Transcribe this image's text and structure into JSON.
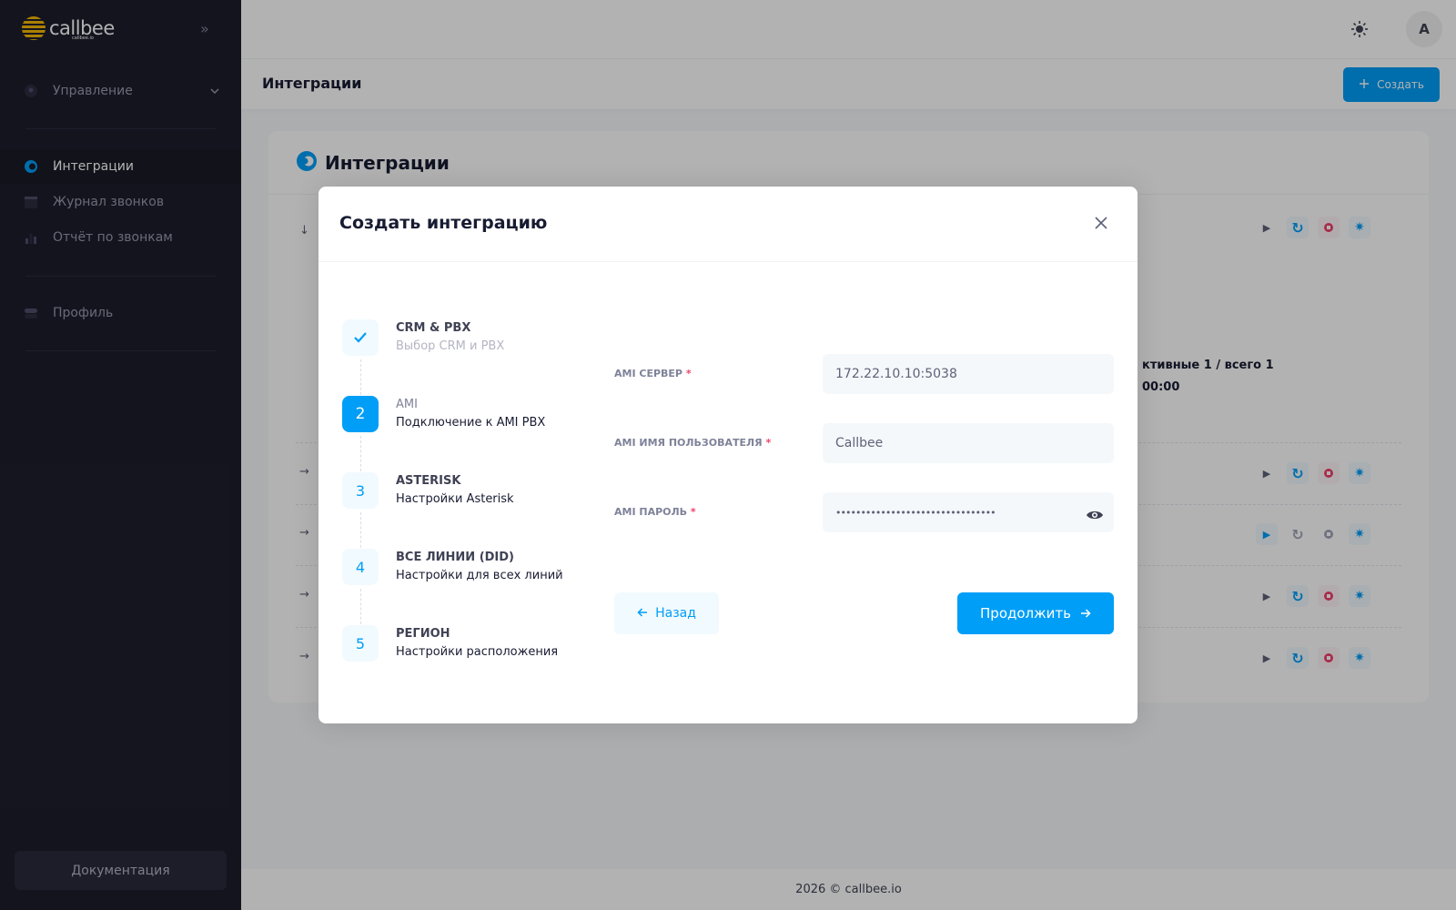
{
  "brand": {
    "name": "callbee",
    "sub": "callbee.io",
    "logo_color": "#f5b800"
  },
  "sidebar": {
    "manage_label": "Управление",
    "items": [
      {
        "label": "Интеграции",
        "icon": "integration-icon"
      },
      {
        "label": "Журнал звонков",
        "icon": "calendar-icon"
      },
      {
        "label": "Отчёт по звонкам",
        "icon": "chart-icon"
      },
      {
        "label": "Профиль",
        "icon": "toggle-icon"
      }
    ],
    "docs_label": "Документация"
  },
  "header": {
    "avatar_letter": "A",
    "theme_icon": "sun-icon"
  },
  "toolbar": {
    "title": "Интеграции",
    "create_label": "Создать"
  },
  "card": {
    "title": "Интеграции",
    "bg_line1": "ктивные 1 / всего 1",
    "bg_line2": "00:00"
  },
  "footer": {
    "text": "2026 © callbee.io"
  },
  "modal": {
    "title": "Создать интеграцию",
    "steps": [
      {
        "number": "",
        "title": "CRM & PBX",
        "desc": "Выбор CRM и PBX",
        "state": "done"
      },
      {
        "number": "2",
        "title": "AMI",
        "desc": "Подключение к AMI PBX",
        "state": "current"
      },
      {
        "number": "3",
        "title": "ASTERISK",
        "desc": "Настройки Asterisk",
        "state": "pending"
      },
      {
        "number": "4",
        "title": "ВСЕ ЛИНИИ (DID)",
        "desc": "Настройки для всех линий",
        "state": "pending"
      },
      {
        "number": "5",
        "title": "РЕГИОН",
        "desc": "Настройки расположения",
        "state": "pending"
      }
    ],
    "fields": [
      {
        "label": "AMI СЕРВЕР",
        "required": "*",
        "value": "172.22.10.10:5038"
      },
      {
        "label": "AMI ИМЯ ПОЛЬЗОВАТЕЛЯ",
        "required": "*",
        "value": "Callbee"
      },
      {
        "label": "AMI ПАРОЛЬ",
        "required": "*",
        "value": "••••••••••••••••••••••••••••••••"
      }
    ],
    "back_label": "Назад",
    "next_label": "Продолжить"
  },
  "colors": {
    "primary": "#009ef7",
    "danger": "#f1416c",
    "sidebar_bg": "#1e1e2d"
  }
}
